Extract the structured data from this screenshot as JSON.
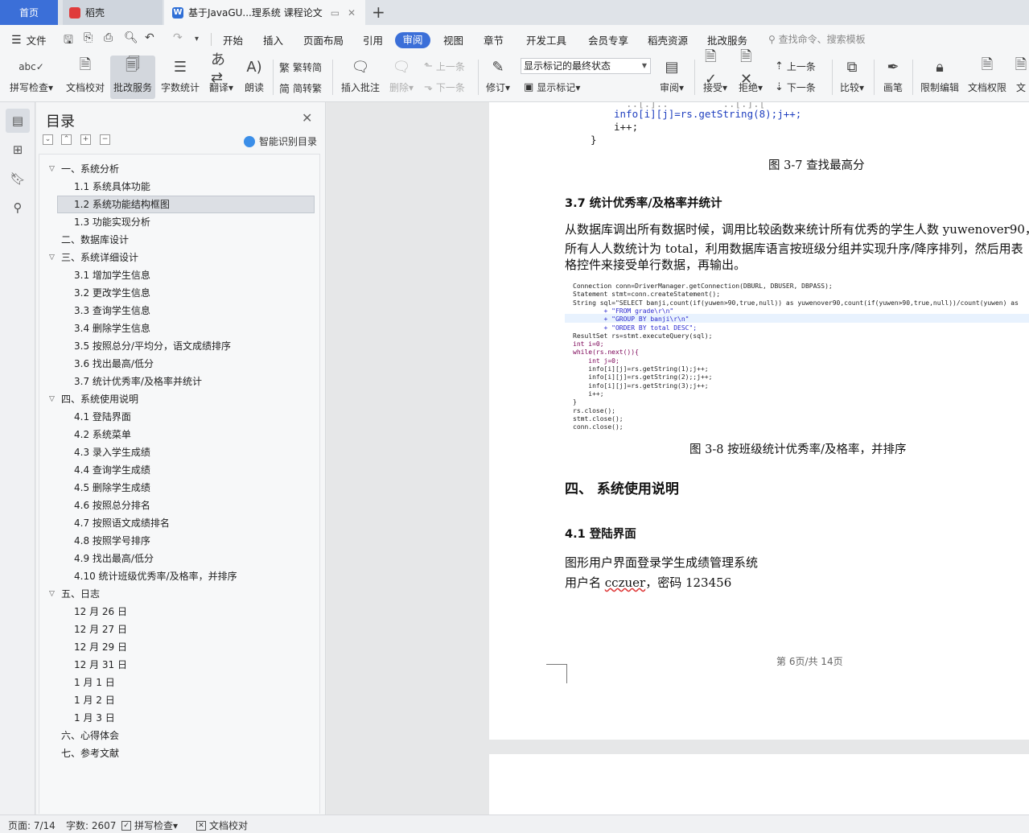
{
  "tabs": {
    "home": "首页",
    "daoke": "稻壳",
    "doc": "基于JavaGU...理系统 课程论文",
    "new_tab": "+"
  },
  "menu": {
    "file": "文件",
    "items": [
      "开始",
      "插入",
      "页面布局",
      "引用",
      "审阅",
      "视图",
      "章节",
      "开发工具",
      "会员专享",
      "稻壳资源",
      "批改服务"
    ],
    "search": "查找命令、搜索模板"
  },
  "ribbon": {
    "spell_check": "拼写检查",
    "doc_proofread": "文档校对",
    "grading": "批改服务",
    "word_count": "字数统计",
    "translate": "翻译",
    "read_aloud": "朗读",
    "trad": "繁转简",
    "simp": "简转繁",
    "insert_comment": "插入批注",
    "delete": "删除",
    "prev": "上一条",
    "next": "下一条",
    "revise": "修订",
    "markup_state": "显示标记的最终状态",
    "show_markup": "显示标记",
    "review": "审阅",
    "accept": "接受",
    "reject": "拒绝",
    "prev2": "上一条",
    "next2": "下一条",
    "compare": "比较",
    "pen": "画笔",
    "restrict_edit": "限制编辑",
    "doc_permission": "文档权限",
    "doc_cut": "文"
  },
  "toc": {
    "title": "目录",
    "smart": "智能识别目录",
    "items": [
      {
        "text": "一、系统分析",
        "level": 1,
        "expand": "down"
      },
      {
        "text": "1.1  系统具体功能",
        "level": 2
      },
      {
        "text": "1.2  系统功能结构框图",
        "level": 2,
        "selected": true
      },
      {
        "text": "1.3  功能实现分析",
        "level": 2
      },
      {
        "text": "二、数据库设计",
        "level": 1
      },
      {
        "text": "三、系统详细设计",
        "level": 1,
        "expand": "down"
      },
      {
        "text": "3.1  增加学生信息",
        "level": 2
      },
      {
        "text": "3.2  更改学生信息",
        "level": 2
      },
      {
        "text": "3.3  查询学生信息",
        "level": 2
      },
      {
        "text": "3.4  删除学生信息",
        "level": 2
      },
      {
        "text": "3.5  按照总分/平均分，语文成绩排序",
        "level": 2
      },
      {
        "text": "3.6  找出最高/低分",
        "level": 2
      },
      {
        "text": "3.7  统计优秀率/及格率并统计",
        "level": 2
      },
      {
        "text": "四、系统使用说明",
        "level": 1,
        "expand": "down"
      },
      {
        "text": "4.1  登陆界面",
        "level": 2
      },
      {
        "text": "4.2  系统菜单",
        "level": 2
      },
      {
        "text": "4.3  录入学生成绩",
        "level": 2
      },
      {
        "text": "4.4 查询学生成绩",
        "level": 2
      },
      {
        "text": "4.5  删除学生成绩",
        "level": 2
      },
      {
        "text": "4.6  按照总分排名",
        "level": 2
      },
      {
        "text": "4.7  按照语文成绩排名",
        "level": 2
      },
      {
        "text": "4.8  按照学号排序",
        "level": 2
      },
      {
        "text": "4.9  找出最高/低分",
        "level": 2
      },
      {
        "text": "4.10  统计班级优秀率/及格率，并排序",
        "level": 2
      },
      {
        "text": "五、日志",
        "level": 1,
        "expand": "down"
      },
      {
        "text": "12 月 26 日",
        "level": 2
      },
      {
        "text": "12 月 27  日",
        "level": 2
      },
      {
        "text": "12 月 29 日",
        "level": 2
      },
      {
        "text": "12 月 31 日",
        "level": 2
      },
      {
        "text": "1 月 1 日",
        "level": 2
      },
      {
        "text": "1 月 2 日",
        "level": 2
      },
      {
        "text": "1 月 3 日",
        "level": 2
      },
      {
        "text": "六、心得体会",
        "level": 1
      },
      {
        "text": "七、参考文献",
        "level": 1
      }
    ]
  },
  "doc": {
    "code_top": [
      "info[i][j]=rs.getString(8);j++;",
      "i++;",
      "}"
    ],
    "fig37": "图 3-7  查找最高分",
    "h37": "3.7  统计优秀率/及格率并统计",
    "para1": [
      "从数据库调出所有数据时候，调用比较函数来统计所有优秀的学生人数 yuwenover90，",
      "所有人人数统计为 total，利用数据库语言按班级分组并实现升序/降序排列，然后用表",
      "格控件来接受单行数据，再输出。"
    ],
    "code_small": [
      "Connection conn=DriverManager.getConnection(DBURL, DBUSER, DBPASS);",
      "Statement stmt=conn.createStatement();",
      "String sql=\"SELECT banji,count(if(yuwen>90,true,null)) as yuwenover90,count(if(yuwen>90,true,null))/count(yuwen) as",
      "        + \"FROM grade\\r\\n\"",
      "        + \"GROUP BY banji\\r\\n\"",
      "        + \"ORDER BY total DESC\";",
      "ResultSet rs=stmt.executeQuery(sql);",
      "int i=0;",
      "while(rs.next()){",
      "    int j=0;",
      "    info[i][j]=rs.getString(1);j++;",
      "    info[i][j]=rs.getString(2);;j++;",
      "    info[i][j]=rs.getString(3);j++;",
      "    i++;",
      "}",
      "rs.close();",
      "stmt.close();",
      "conn.close();"
    ],
    "fig38": "图 3-8  按班级统计优秀率/及格率，并排序",
    "h4": "四、    系统使用说明",
    "h41": "4.1  登陆界面",
    "para2": "图形用户界面登录学生成绩管理系统",
    "para3_prefix": "用户名 ",
    "para3_user": "cczuer",
    "para3_suffix": "，密码 123456",
    "page_num": "第 6页/共 14页"
  },
  "status": {
    "page": "页面: 7/14",
    "words": "字数: 2607",
    "spell": "拼写检查",
    "proof": "文档校对"
  }
}
